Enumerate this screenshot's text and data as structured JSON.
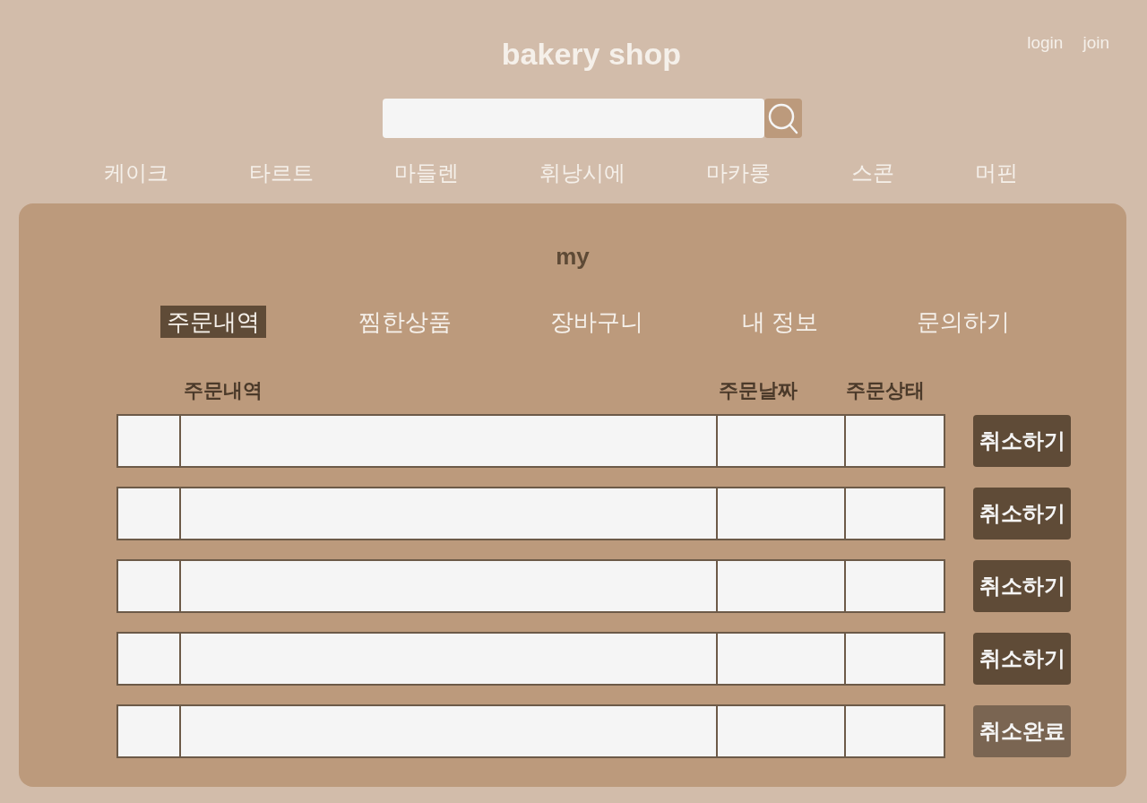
{
  "header": {
    "title": "bakery shop",
    "links": [
      {
        "label": "login"
      },
      {
        "label": "join"
      }
    ]
  },
  "categories": [
    "케이크",
    "타르트",
    "마들렌",
    "휘낭시에",
    "마카롱",
    "스콘",
    "머핀"
  ],
  "panel": {
    "title": "my",
    "tabs": [
      {
        "label": "주문내역",
        "selected": true
      },
      {
        "label": "찜한상품",
        "selected": false
      },
      {
        "label": "장바구니",
        "selected": false
      },
      {
        "label": "내 정보",
        "selected": false
      },
      {
        "label": "문의하기",
        "selected": false
      }
    ],
    "table": {
      "columns": [
        "주문내역",
        "주문날짜",
        "주문상태"
      ],
      "rows": [
        {
          "action": "취소하기",
          "disabled": false
        },
        {
          "action": "취소하기",
          "disabled": false
        },
        {
          "action": "취소하기",
          "disabled": false
        },
        {
          "action": "취소하기",
          "disabled": false
        },
        {
          "action": "취소완료",
          "disabled": true
        }
      ]
    }
  }
}
